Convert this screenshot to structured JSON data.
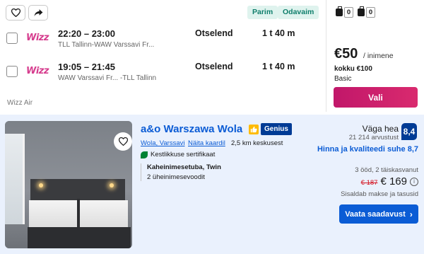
{
  "flight": {
    "tags": {
      "best": "Parim",
      "cheapest": "Odavaim"
    },
    "legs": [
      {
        "airline_logo": "Wizz",
        "time": "22:20 – 23:00",
        "route": "TLL Tallinn-WAW Varssavi Fr...",
        "type": "Otselend",
        "duration": "1 t 40 m"
      },
      {
        "airline_logo": "Wizz",
        "time": "19:05 – 21:45",
        "route": "WAW Varssavi Fr... -TLL Tallinn",
        "type": "Otselend",
        "duration": "1 t 40 m"
      }
    ],
    "airline": "Wizz Air",
    "bags": [
      {
        "icon": "personal-item-icon",
        "count": "0"
      },
      {
        "icon": "cabin-bag-icon",
        "count": "0"
      }
    ],
    "price": "€50",
    "price_per": "/ inimene",
    "price_total": "kokku €100",
    "fare_class": "Basic",
    "select_label": "Vali",
    "colors": {
      "select_button": "#c1176a",
      "tag_bg": "#dff3ee",
      "tag_text": "#0e7e6b",
      "wizz_logo": "#d63d8e"
    }
  },
  "hotel": {
    "name": "a&o Warszawa Wola",
    "genius": "Genius",
    "location": "Wola, Varssavi",
    "map_link": "Näita kaardil",
    "distance": "2,5 km keskusest",
    "sustainability": "Kestlikkuse sertifikaat",
    "room_title": "Kaheinimesetuba, Twin",
    "room_beds": "2 üheinimesevoodit",
    "rating_word": "Väga hea",
    "rating_count": "21 214 arvustust",
    "rating_score": "8,4",
    "value_text": "Hinna ja kvaliteedi suhe 8,7",
    "stay_info": "3 ööd, 2 täiskasvanut",
    "price_old": "€ 187",
    "price_new": "€ 169",
    "info_icon": "i",
    "tax_note": "Sisaldab makse ja tasusid",
    "see_label": "Vaata saadavust",
    "colors": {
      "link": "#0b5cd5",
      "score_bg": "#003b95",
      "genius_bg": "#003b95",
      "card_bg": "#eaf1fd",
      "old_price": "#d4111e"
    }
  }
}
